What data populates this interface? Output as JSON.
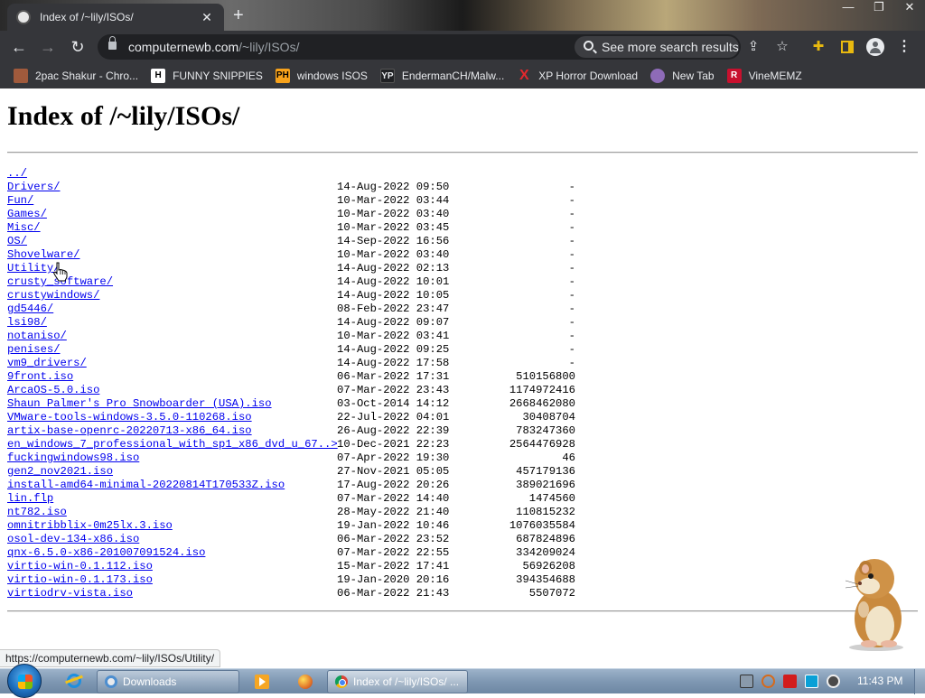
{
  "browser": {
    "tab_title": "Index of /~lily/ISOs/",
    "tab_close": "✕",
    "new_tab": "+",
    "window_controls": [
      "—",
      "❐",
      "✕"
    ],
    "url_host": "computernewb.com",
    "url_path": "/~lily/ISOs/",
    "search_chip": "See more search results"
  },
  "bookmarks": [
    {
      "label": "2pac Shakur - Chro...",
      "icon": "avatar-image-icon",
      "glyph": ""
    },
    {
      "label": "FUNNY SNIPPIES",
      "icon": "h-logo-icon",
      "glyph": "H"
    },
    {
      "label": "windows ISOS",
      "icon": "ph-logo-icon",
      "glyph": "PH"
    },
    {
      "label": "EndermanCH/Malw...",
      "icon": "yp-logo-icon",
      "glyph": "YP"
    },
    {
      "label": "XP Horror Download",
      "icon": "x-logo-icon",
      "glyph": "X"
    },
    {
      "label": "New Tab",
      "icon": "globe-icon",
      "glyph": ""
    },
    {
      "label": "VineMEMZ",
      "icon": "r-logo-icon",
      "glyph": "R"
    }
  ],
  "page": {
    "heading": "Index of /~lily/ISOs/",
    "entries": [
      {
        "name": "../",
        "date": "",
        "size": ""
      },
      {
        "name": "Drivers/",
        "date": "14-Aug-2022 09:50",
        "size": "-"
      },
      {
        "name": "Fun/",
        "date": "10-Mar-2022 03:44",
        "size": "-"
      },
      {
        "name": "Games/",
        "date": "10-Mar-2022 03:40",
        "size": "-"
      },
      {
        "name": "Misc/",
        "date": "10-Mar-2022 03:45",
        "size": "-"
      },
      {
        "name": "OS/",
        "date": "14-Sep-2022 16:56",
        "size": "-"
      },
      {
        "name": "Shovelware/",
        "date": "10-Mar-2022 03:40",
        "size": "-"
      },
      {
        "name": "Utility/",
        "date": "14-Aug-2022 02:13",
        "size": "-"
      },
      {
        "name": "crusty_software/",
        "date": "14-Aug-2022 10:01",
        "size": "-"
      },
      {
        "name": "crustywindows/",
        "date": "14-Aug-2022 10:05",
        "size": "-"
      },
      {
        "name": "gd5446/",
        "date": "08-Feb-2022 23:47",
        "size": "-"
      },
      {
        "name": "lsi98/",
        "date": "14-Aug-2022 09:07",
        "size": "-"
      },
      {
        "name": "notaniso/",
        "date": "10-Mar-2022 03:41",
        "size": "-"
      },
      {
        "name": "penises/",
        "date": "14-Aug-2022 09:25",
        "size": "-"
      },
      {
        "name": "vm9_drivers/",
        "date": "14-Aug-2022 17:58",
        "size": "-"
      },
      {
        "name": "9front.iso",
        "date": "06-Mar-2022 17:31",
        "size": "510156800"
      },
      {
        "name": "ArcaOS-5.0.iso",
        "date": "07-Mar-2022 23:43",
        "size": "1174972416"
      },
      {
        "name": "Shaun Palmer's Pro Snowboarder (USA).iso",
        "date": "03-Oct-2014 14:12",
        "size": "2668462080"
      },
      {
        "name": "VMware-tools-windows-3.5.0-110268.iso",
        "date": "22-Jul-2022 04:01",
        "size": "30408704"
      },
      {
        "name": "artix-base-openrc-20220713-x86_64.iso",
        "date": "26-Aug-2022 22:39",
        "size": "783247360"
      },
      {
        "name": "en_windows_7_professional_with_sp1_x86_dvd_u_67..>",
        "date": "10-Dec-2021 22:23",
        "size": "2564476928"
      },
      {
        "name": "fuckingwindows98.iso",
        "date": "07-Apr-2022 19:30",
        "size": "46"
      },
      {
        "name": "gen2_nov2021.iso",
        "date": "27-Nov-2021 05:05",
        "size": "457179136"
      },
      {
        "name": "install-amd64-minimal-20220814T170533Z.iso",
        "date": "17-Aug-2022 20:26",
        "size": "389021696"
      },
      {
        "name": "lin.flp",
        "date": "07-Mar-2022 14:40",
        "size": "1474560"
      },
      {
        "name": "nt782.iso",
        "date": "28-May-2022 21:40",
        "size": "110815232"
      },
      {
        "name": "omnitribblix-0m25lx.3.iso",
        "date": "19-Jan-2022 10:46",
        "size": "1076035584"
      },
      {
        "name": "osol-dev-134-x86.iso",
        "date": "06-Mar-2022 23:52",
        "size": "687824896"
      },
      {
        "name": "qnx-6.5.0-x86-201007091524.iso",
        "date": "07-Mar-2022 22:55",
        "size": "334209024"
      },
      {
        "name": "virtio-win-0.1.112.iso",
        "date": "15-Mar-2022 17:41",
        "size": "56926208"
      },
      {
        "name": "virtio-win-0.1.173.iso",
        "date": "19-Jan-2020 20:16",
        "size": "394354688"
      },
      {
        "name": "virtiodrv-vista.iso",
        "date": "06-Mar-2022 21:43",
        "size": "5507072"
      }
    ]
  },
  "status_bar": "https://computernewb.com/~lily/ISOs/Utility/",
  "taskbar": {
    "downloads_label": "Downloads",
    "chrome_label": "Index of /~lily/ISOs/ ...",
    "clock": "11:43 PM"
  },
  "colors": {
    "link": "#0000ee",
    "chrome_dark": "#35363a",
    "taskbar": "#7f98b3"
  }
}
